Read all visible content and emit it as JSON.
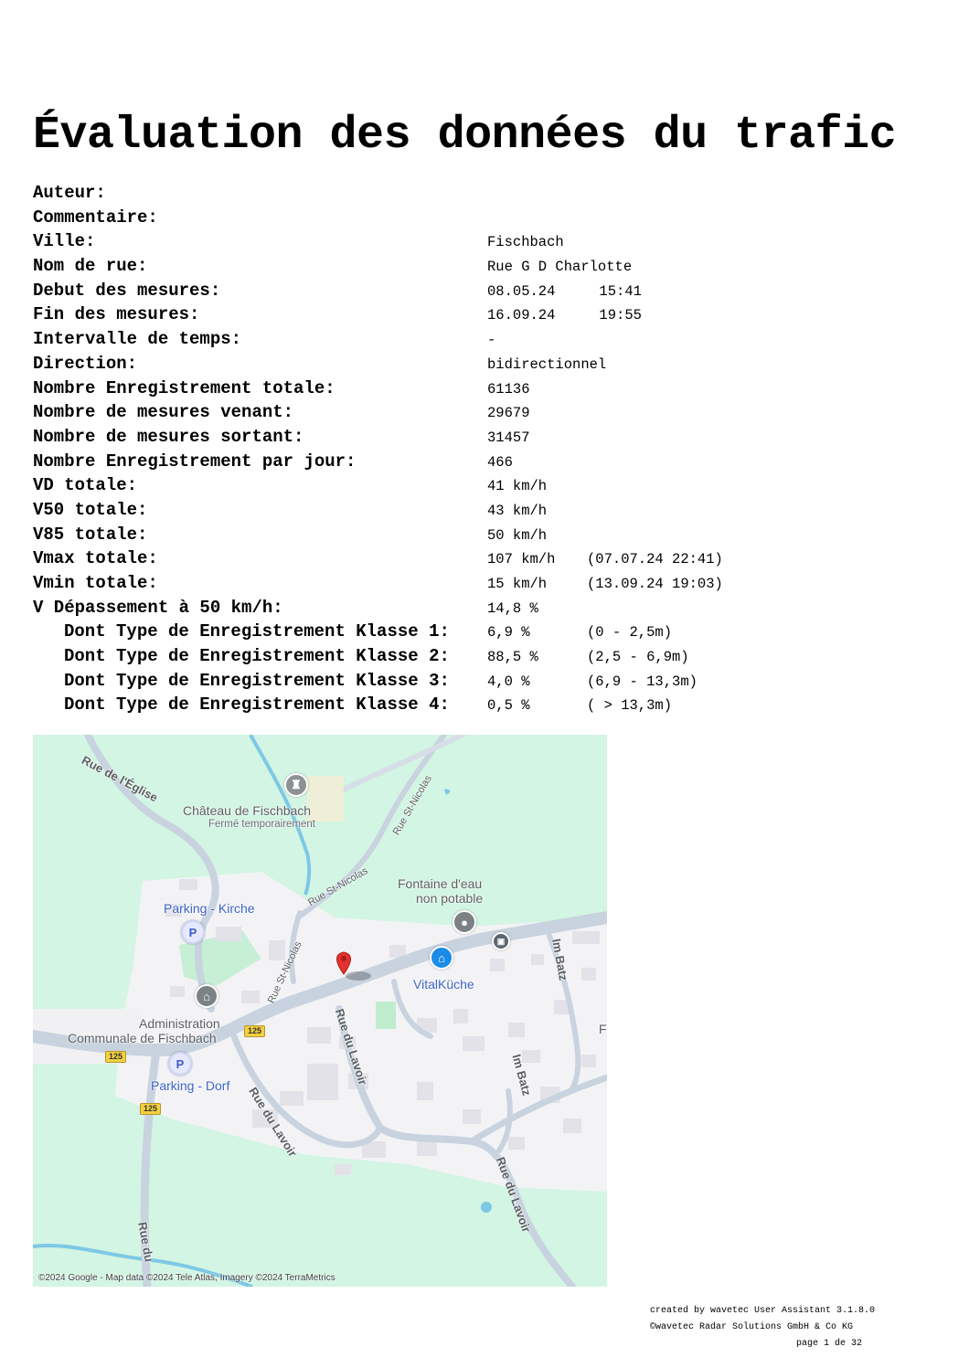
{
  "title": "Évaluation des données du trafic",
  "fields": [
    {
      "label": "Auteur:",
      "value": "",
      "extra": "",
      "sub": false
    },
    {
      "label": "Commentaire:",
      "value": "",
      "extra": "",
      "sub": false
    },
    {
      "label": "Ville:",
      "value": "Fischbach",
      "extra": "",
      "sub": false
    },
    {
      "label": "Nom de rue:",
      "value": "Rue G D Charlotte",
      "extra": "",
      "sub": false
    },
    {
      "label": "Debut des mesures:",
      "value": "08.05.24",
      "time": "15:41",
      "extra": "",
      "sub": false
    },
    {
      "label": "Fin des mesures:",
      "value": "16.09.24",
      "time": "19:55",
      "extra": "",
      "sub": false
    },
    {
      "label": "Intervalle de temps:",
      "value": "-",
      "extra": "",
      "sub": false
    },
    {
      "label": "Direction:",
      "value": "bidirectionnel",
      "extra": "",
      "sub": false
    },
    {
      "label": "Nombre Enregistrement totale:",
      "value": "61136",
      "extra": "",
      "sub": false
    },
    {
      "label": "Nombre de mesures venant:",
      "value": "29679",
      "extra": "",
      "sub": false
    },
    {
      "label": "Nombre de mesures sortant:",
      "value": "31457",
      "extra": "",
      "sub": false
    },
    {
      "label": "Nombre Enregistrement par jour:",
      "value": "466",
      "extra": "",
      "sub": false
    },
    {
      "label": "VD totale:",
      "value": "41 km/h",
      "extra": "",
      "sub": false
    },
    {
      "label": "V50 totale:",
      "value": "43 km/h",
      "extra": "",
      "sub": false
    },
    {
      "label": "V85 totale:",
      "value": "50 km/h",
      "extra": "",
      "sub": false
    },
    {
      "label": "Vmax totale:",
      "value": "107 km/h",
      "extra": "(07.07.24    22:41)",
      "sub": false
    },
    {
      "label": "Vmin totale:",
      "value": "15 km/h",
      "extra": "(13.09.24    19:03)",
      "sub": false
    },
    {
      "label": "V Dépassement à 50 km/h:",
      "value": "14,8 %",
      "extra": "",
      "sub": false
    },
    {
      "label": "Dont Type de Enregistrement Klasse 1:",
      "value": "6,9 %",
      "extra": "(0 - 2,5m)",
      "sub": true
    },
    {
      "label": "Dont Type de Enregistrement Klasse 2:",
      "value": "88,5 %",
      "extra": "(2,5 - 6,9m)",
      "sub": true
    },
    {
      "label": "Dont Type de Enregistrement Klasse 3:",
      "value": "4,0 %",
      "extra": "(6,9 - 13,3m)",
      "sub": true
    },
    {
      "label": "Dont Type de Enregistrement Klasse 4:",
      "value": "0,5 %",
      "extra": "( > 13,3m)",
      "sub": true
    }
  ],
  "map": {
    "labels": {
      "chateau": "Château de Fischbach",
      "chateau_status": "Fermé temporairement",
      "fontaine_1": "Fontaine d'eau",
      "fontaine_2": "non potable",
      "parking_kirche": "Parking - Kirche",
      "vitalkuche": "VitalKüche",
      "admin_1": "Administration",
      "admin_2": "Communale de Fischbach",
      "parking_dorf": "Parking - Dorf",
      "rue_eglise": "Rue de l'Église",
      "rue_st_nicolas": "Rue St-Nicolas",
      "rue_du_lavoir": "Rue du Lavoir",
      "im_batz": "Im Batz",
      "rue_du": "Rue du",
      "partial_letter": "F",
      "route_125": "125",
      "parking_symbol": "P"
    },
    "attribution": "©2024 Google - Map data ©2024 Tele Atlas, Imagery ©2024 TerraMetrics",
    "colors": {
      "background": "#d3f5e3",
      "urban": "#f3f3f6",
      "road": "#c8d3df",
      "water": "#7dc8e6",
      "marker": "#e5322f"
    }
  },
  "footer": {
    "created": "created by wavetec User Assistant 3.1.8.0",
    "copyright": "©wavetec Radar Solutions GmbH & Co KG",
    "page": "page 1 de 32"
  }
}
